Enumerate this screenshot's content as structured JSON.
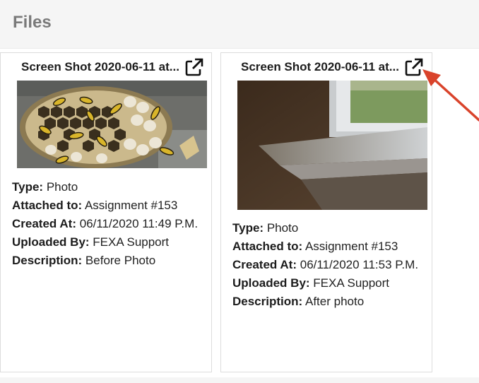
{
  "header": {
    "title": "Files"
  },
  "files": [
    {
      "title": "Screen Shot 2020-06-11 at...",
      "external_link_icon": "external-link-icon",
      "image_subject": "wasp-nest",
      "type_label": "Type:",
      "type_value": "Photo",
      "attached_label": "Attached to:",
      "attached_value": "Assignment #153",
      "created_label": "Created At:",
      "created_value": "06/11/2020 11:49 P.M.",
      "uploaded_label": "Uploaded By:",
      "uploaded_value": "FEXA Support",
      "description_label": "Description:",
      "description_value": "Before Photo"
    },
    {
      "title": "Screen Shot 2020-06-11 at...",
      "external_link_icon": "external-link-icon",
      "image_subject": "window-sill",
      "type_label": "Type:",
      "type_value": "Photo",
      "attached_label": "Attached to:",
      "attached_value": "Assignment #153",
      "created_label": "Created At:",
      "created_value": "06/11/2020 11:53 P.M.",
      "uploaded_label": "Uploaded By:",
      "uploaded_value": "FEXA Support",
      "description_label": "Description:",
      "description_value": "After photo"
    }
  ],
  "annotation": {
    "arrow_color": "#d9432b"
  },
  "colors": {
    "header_bg": "#f5f5f5",
    "header_text": "#7a7a7a",
    "card_border": "#dcdcdc"
  }
}
